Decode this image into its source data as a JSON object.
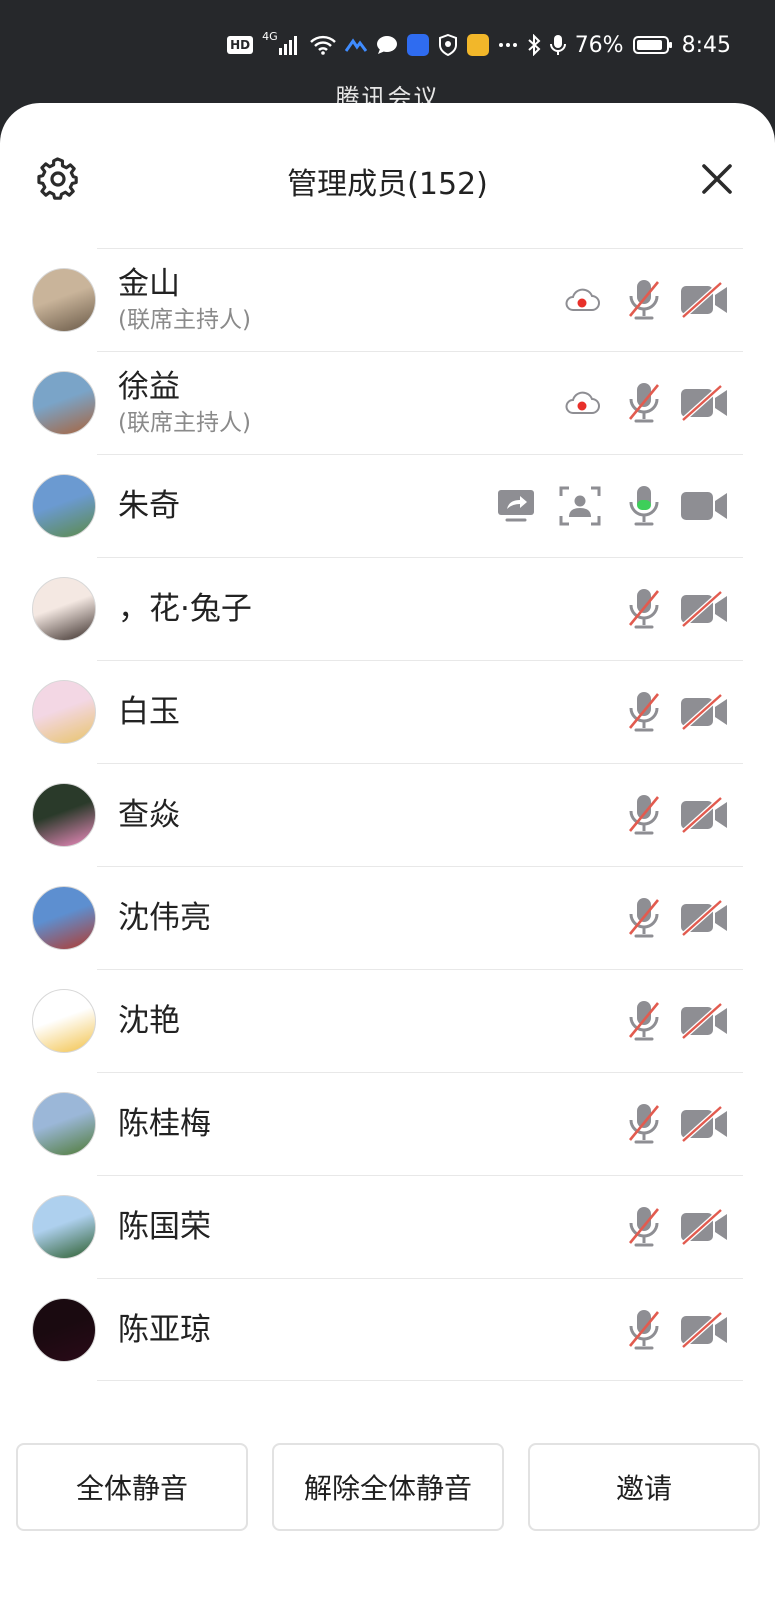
{
  "status_bar": {
    "network": "4G",
    "battery": "76%",
    "time": "8:45",
    "icons": [
      "hd-icon",
      "signal-icon",
      "wifi-icon",
      "app-icon",
      "chat-icon",
      "app-tile-icon",
      "shield-icon",
      "weibo-icon",
      "more-icon",
      "bluetooth-icon",
      "mic-icon",
      "battery-icon"
    ]
  },
  "underlay": {
    "app_title": "腾讯会议"
  },
  "header": {
    "title": "管理成员(152)",
    "settings_icon": "gear-icon",
    "close_icon": "close-icon"
  },
  "members": [
    {
      "name": "金山",
      "role": "(联席主持人)",
      "recording": true,
      "sharing": false,
      "spotlight": false,
      "mic_on": false,
      "cam_on": false
    },
    {
      "name": "徐益",
      "role": "(联席主持人)",
      "recording": true,
      "sharing": false,
      "spotlight": false,
      "mic_on": false,
      "cam_on": false
    },
    {
      "name": "朱奇",
      "role": "",
      "recording": false,
      "sharing": true,
      "spotlight": true,
      "mic_on": true,
      "cam_on": true
    },
    {
      "name": "，花·兔子",
      "role": "",
      "recording": false,
      "sharing": false,
      "spotlight": false,
      "mic_on": false,
      "cam_on": false
    },
    {
      "name": "白玉",
      "role": "",
      "recording": false,
      "sharing": false,
      "spotlight": false,
      "mic_on": false,
      "cam_on": false
    },
    {
      "name": "查焱",
      "role": "",
      "recording": false,
      "sharing": false,
      "spotlight": false,
      "mic_on": false,
      "cam_on": false
    },
    {
      "name": "沈伟亮",
      "role": "",
      "recording": false,
      "sharing": false,
      "spotlight": false,
      "mic_on": false,
      "cam_on": false
    },
    {
      "name": "沈艳",
      "role": "",
      "recording": false,
      "sharing": false,
      "spotlight": false,
      "mic_on": false,
      "cam_on": false
    },
    {
      "name": "陈桂梅",
      "role": "",
      "recording": false,
      "sharing": false,
      "spotlight": false,
      "mic_on": false,
      "cam_on": false
    },
    {
      "name": "陈国荣",
      "role": "",
      "recording": false,
      "sharing": false,
      "spotlight": false,
      "mic_on": false,
      "cam_on": false
    },
    {
      "name": "陈亚琼",
      "role": "",
      "recording": false,
      "sharing": false,
      "spotlight": false,
      "mic_on": false,
      "cam_on": false
    }
  ],
  "actions": {
    "mute_all": "全体静音",
    "unmute_all": "解除全体静音",
    "invite": "邀请"
  },
  "colors": {
    "icon_gray": "#8e8e93",
    "strike_red": "#e25b4f",
    "record_red": "#e8302a",
    "mic_active_green": "#3ecf5a"
  }
}
